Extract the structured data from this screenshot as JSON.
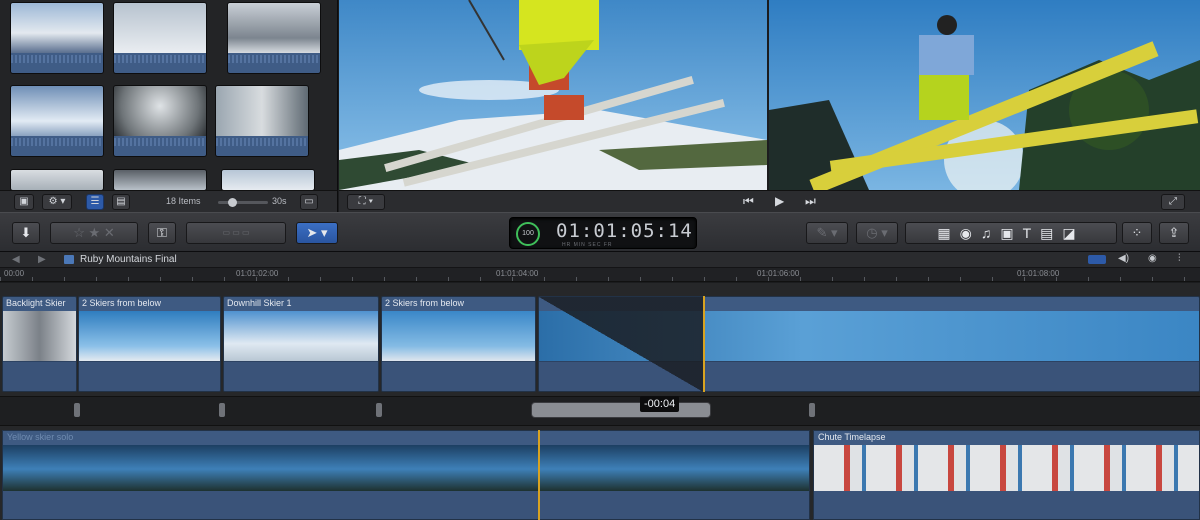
{
  "browser": {
    "item_count": "18 Items",
    "duration": "30s"
  },
  "toolbar": {
    "timecode": "01:01:05:14",
    "timecode_units": "HR   MIN   SEC   FR",
    "percent": "100"
  },
  "timeline": {
    "project_name": "Ruby Mountains Final",
    "ruler": [
      "00:00",
      "01:01:02:00",
      "01:01:04:00",
      "01:01:06:00",
      "01:01:08:00"
    ],
    "clips": [
      {
        "name": "Backlight Skier"
      },
      {
        "name": "2 Skiers from below"
      },
      {
        "name": "Downhill Skier 1"
      },
      {
        "name": "2 Skiers from below"
      }
    ],
    "lower_clips": [
      {
        "name": "Yellow skier solo"
      },
      {
        "name": "Chute Timelapse"
      }
    ],
    "transition_duration": "-00:04"
  },
  "colors": {
    "clip_blue": "#3e5a82",
    "playhead": "#d8a321",
    "accent_blue": "#2d5aa8",
    "timecode_ring": "#3fbf5a"
  }
}
